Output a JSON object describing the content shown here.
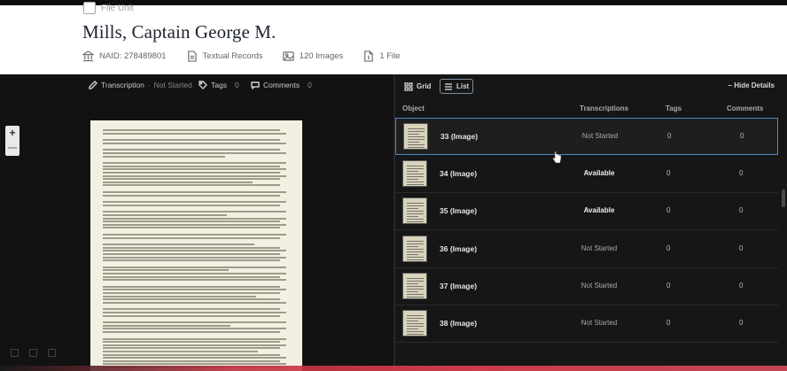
{
  "header": {
    "file_unit_label": "File Unit",
    "title": "Mills, Captain George M.",
    "naid": "NAID: 278489801",
    "record_type": "Textual Records",
    "images": "120 Images",
    "files": "1 File"
  },
  "viewer": {
    "tabs": [
      {
        "label": "Transcription",
        "status": "Not Started"
      },
      {
        "label": "Tags",
        "count": "0"
      },
      {
        "label": "Comments",
        "count": "0"
      }
    ],
    "zoom_in": "+"
  },
  "list": {
    "view_grid": "Grid",
    "view_list": "List",
    "hide_details": "Hide Details",
    "columns": [
      "Object",
      "Transcriptions",
      "Tags",
      "Comments"
    ],
    "rows": [
      {
        "name": "33 (Image)",
        "status": "Not Started",
        "tags": "0",
        "comments": "0",
        "selected": true
      },
      {
        "name": "34 (Image)",
        "status": "Available",
        "tags": "0",
        "comments": "0"
      },
      {
        "name": "35 (Image)",
        "status": "Available",
        "tags": "0",
        "comments": "0"
      },
      {
        "name": "36 (Image)",
        "status": "Not Started",
        "tags": "0",
        "comments": "0"
      },
      {
        "name": "37 (Image)",
        "status": "Not Started",
        "tags": "0",
        "comments": "0"
      },
      {
        "name": "38 (Image)",
        "status": "Not Started",
        "tags": "0",
        "comments": "0"
      }
    ]
  },
  "icons": {
    "naid": "building-icon",
    "records": "document-icon",
    "images": "image-icon",
    "files": "file-icon"
  },
  "colors": {
    "selected_border": "#4f86c6",
    "header_bg": "#ffffff",
    "panel_bg": "#161616"
  }
}
